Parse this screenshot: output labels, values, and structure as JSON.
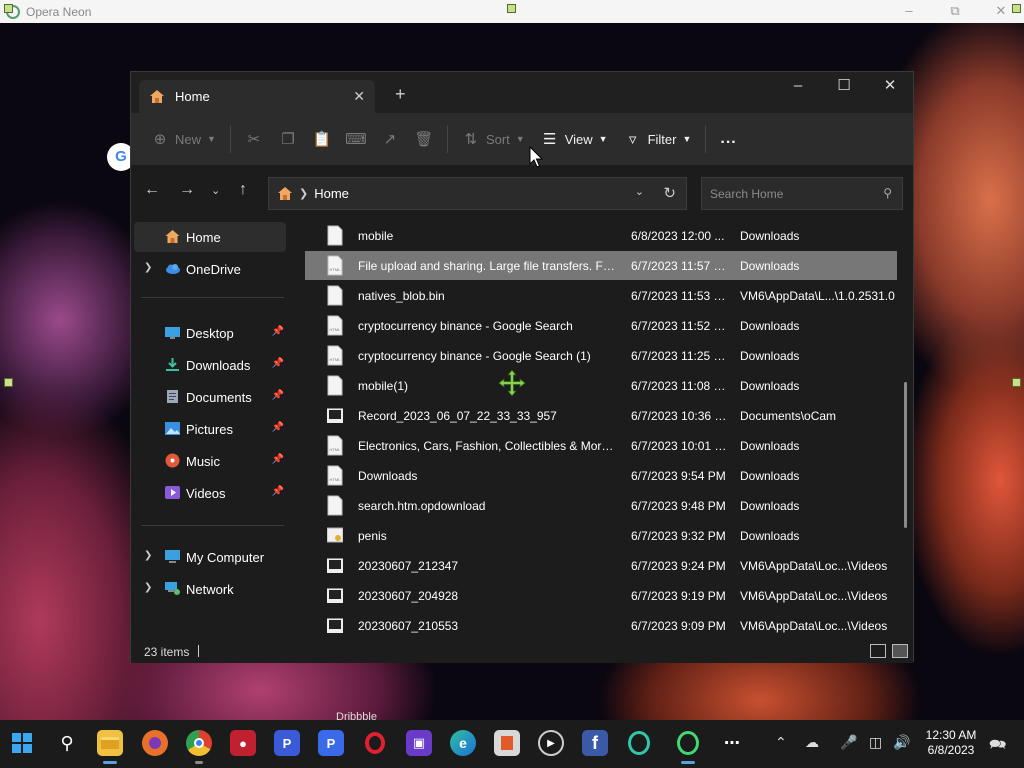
{
  "app": {
    "title": "Opera Neon"
  },
  "explorer": {
    "tab": {
      "label": "Home"
    },
    "toolbar": {
      "new": "New",
      "sort": "Sort",
      "view": "View",
      "filter": "Filter",
      "more": "..."
    },
    "address": {
      "path": "Home"
    },
    "search": {
      "placeholder": "Search Home"
    },
    "sidebar": {
      "items": [
        {
          "label": "Home",
          "icon": "home-icon"
        },
        {
          "label": "OneDrive",
          "icon": "cloud-icon"
        },
        {
          "label": "Desktop",
          "icon": "desktop-icon"
        },
        {
          "label": "Downloads",
          "icon": "download-icon"
        },
        {
          "label": "Documents",
          "icon": "document-icon"
        },
        {
          "label": "Pictures",
          "icon": "picture-icon"
        },
        {
          "label": "Music",
          "icon": "music-icon"
        },
        {
          "label": "Videos",
          "icon": "video-icon"
        },
        {
          "label": "My Computer",
          "icon": "computer-icon"
        },
        {
          "label": "Network",
          "icon": "network-icon"
        }
      ]
    },
    "files": [
      {
        "name": "mobile",
        "date": "6/8/2023 12:00 ...",
        "location": "Downloads",
        "icon": "blank"
      },
      {
        "name": "File upload and sharing. Large file transfers. Fre...",
        "date": "6/7/2023 11:57 P...",
        "location": "Downloads",
        "icon": "html"
      },
      {
        "name": "natives_blob.bin",
        "date": "6/7/2023 11:53 P...",
        "location": "VM6\\AppData\\L...\\1.0.2531.0",
        "icon": "blank"
      },
      {
        "name": "cryptocurrency binance - Google Search",
        "date": "6/7/2023 11:52 P...",
        "location": "Downloads",
        "icon": "html"
      },
      {
        "name": "cryptocurrency binance - Google Search (1)",
        "date": "6/7/2023 11:25 P...",
        "location": "Downloads",
        "icon": "html"
      },
      {
        "name": "mobile(1)",
        "date": "6/7/2023 11:08 P...",
        "location": "Downloads",
        "icon": "blank"
      },
      {
        "name": "Record_2023_06_07_22_33_33_957",
        "date": "6/7/2023 10:36 P...",
        "location": "Documents\\oCam",
        "icon": "video"
      },
      {
        "name": "Electronics, Cars, Fashion, Collectibles & More ...",
        "date": "6/7/2023 10:01 P...",
        "location": "Downloads",
        "icon": "html"
      },
      {
        "name": "Downloads",
        "date": "6/7/2023 9:54 PM",
        "location": "Downloads",
        "icon": "html"
      },
      {
        "name": "search.htm.opdownload",
        "date": "6/7/2023 9:48 PM",
        "location": "Downloads",
        "icon": "blank"
      },
      {
        "name": "penis",
        "date": "6/7/2023 9:32 PM",
        "location": "Downloads",
        "icon": "cert"
      },
      {
        "name": "20230607_212347",
        "date": "6/7/2023 9:24 PM",
        "location": "VM6\\AppData\\Loc...\\Videos",
        "icon": "video"
      },
      {
        "name": "20230607_204928",
        "date": "6/7/2023 9:19 PM",
        "location": "VM6\\AppData\\Loc...\\Videos",
        "icon": "video"
      },
      {
        "name": "20230607_210553",
        "date": "6/7/2023 9:09 PM",
        "location": "VM6\\AppData\\Loc...\\Videos",
        "icon": "video"
      }
    ],
    "status": {
      "count": "23 items"
    }
  },
  "desktop": {
    "widget_label": "Dribbble"
  },
  "taskbar": {
    "time": "12:30 AM",
    "date": "6/8/2023"
  },
  "colors": {
    "accent": "#5aa0e0",
    "window_bg": "#1c1c1c",
    "selection": "#777777"
  }
}
